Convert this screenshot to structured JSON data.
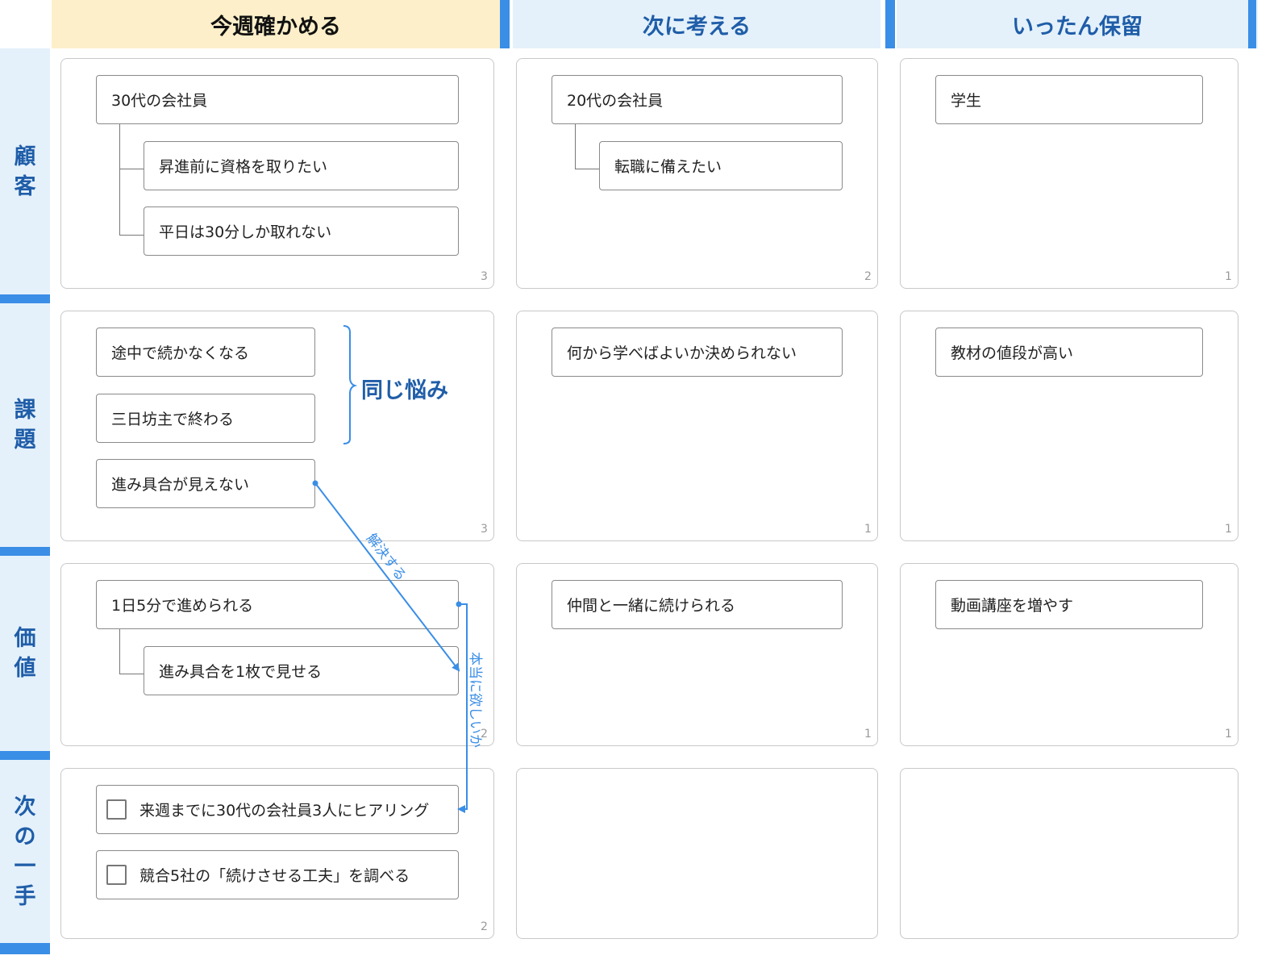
{
  "columns": [
    "今週確かめる",
    "次に考える",
    "いったん保留"
  ],
  "rows": {
    "customer": [
      "顧",
      "客"
    ],
    "issue": [
      "課",
      "題"
    ],
    "value": [
      "価",
      "値"
    ],
    "next": [
      "次",
      "の",
      "一",
      "手"
    ]
  },
  "cells": {
    "customer": {
      "week": {
        "count": "3",
        "cards": [
          "30代の会社員",
          "昇進前に資格を取りたい",
          "平日は30分しか取れない"
        ]
      },
      "next": {
        "count": "2",
        "cards": [
          "20代の会社員",
          "転職に備えたい"
        ]
      },
      "hold": {
        "count": "1",
        "cards": [
          "学生"
        ]
      }
    },
    "issue": {
      "week": {
        "count": "3",
        "cards": [
          "途中で続かなくなる",
          "三日坊主で終わる",
          "進み具合が見えない"
        ],
        "group_label": "同じ悩み"
      },
      "next": {
        "count": "1",
        "cards": [
          "何から学べばよいか決められない"
        ]
      },
      "hold": {
        "count": "1",
        "cards": [
          "教材の値段が高い"
        ]
      }
    },
    "value": {
      "week": {
        "count": "2",
        "cards": [
          "1日5分で進められる",
          "進み具合を1枚で見せる"
        ]
      },
      "next": {
        "count": "1",
        "cards": [
          "仲間と一緒に続けられる"
        ]
      },
      "hold": {
        "count": "1",
        "cards": [
          "動画講座を増やす"
        ]
      }
    },
    "next_step": {
      "week": {
        "count": "2",
        "tasks": [
          "来週までに30代の会社員3人にヒアリング",
          "競合5社の「続けさせる工夫」を調べる"
        ]
      }
    }
  },
  "arrows": {
    "solves": "解決する",
    "really_wanted": "本当に欲しいか"
  },
  "colors": {
    "accent": "#3a8ee6",
    "header_text": "#1f5da8",
    "week_header_bg": "#fcefc9",
    "header_bg": "#e4f1fb"
  }
}
